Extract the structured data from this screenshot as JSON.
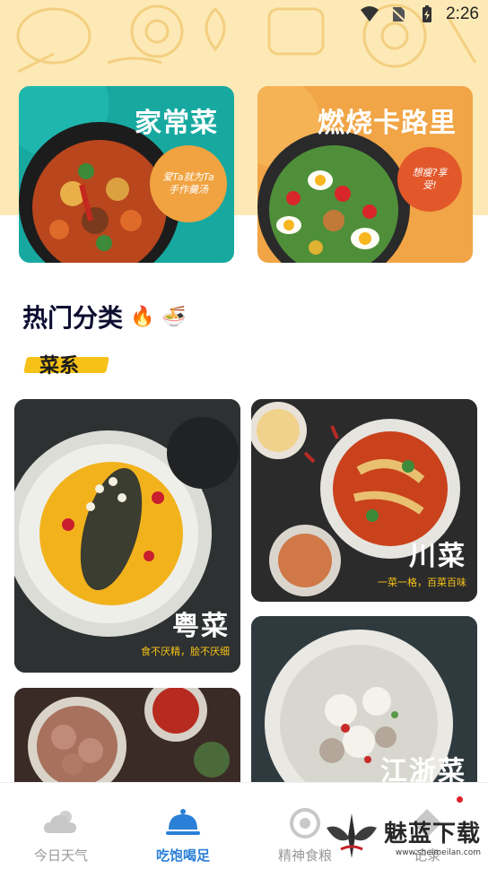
{
  "status_bar": {
    "time": "2:26"
  },
  "banners": [
    {
      "title": "家常菜",
      "bubble_text": "爱Ta就为Ta手作羹汤"
    },
    {
      "title": "燃烧卡路里",
      "bubble_text": "想瘦?享受!"
    }
  ],
  "section": {
    "title": "热门分类",
    "emoji_1": "🔥",
    "emoji_2": "🍜",
    "tag": "菜系"
  },
  "cards": [
    {
      "name": "粤菜",
      "subtitle": "食不厌精，脍不厌细"
    },
    {
      "name": "川菜",
      "subtitle": "一菜一格，百菜百味"
    },
    {
      "name": "",
      "subtitle": ""
    },
    {
      "name": "江浙菜",
      "subtitle": ""
    }
  ],
  "bottom_nav": [
    {
      "label": "今日天气",
      "icon": "weather-cloud-sun-icon",
      "active": false
    },
    {
      "label": "吃饱喝足",
      "icon": "food-cloche-icon",
      "active": true
    },
    {
      "label": "精神食粮",
      "icon": "camera-aperture-icon",
      "active": false
    },
    {
      "label": "记录",
      "icon": "note-icon",
      "active": false
    }
  ],
  "watermark": {
    "text": "魅蓝下载",
    "url": "www.sheimeilan.com"
  },
  "colors": {
    "accent": "#2a7fd6",
    "tag_yellow": "#f6c218",
    "banner_teal": "#17a9a0",
    "banner_orange": "#f1a546",
    "top_bg": "#fde9b5"
  }
}
